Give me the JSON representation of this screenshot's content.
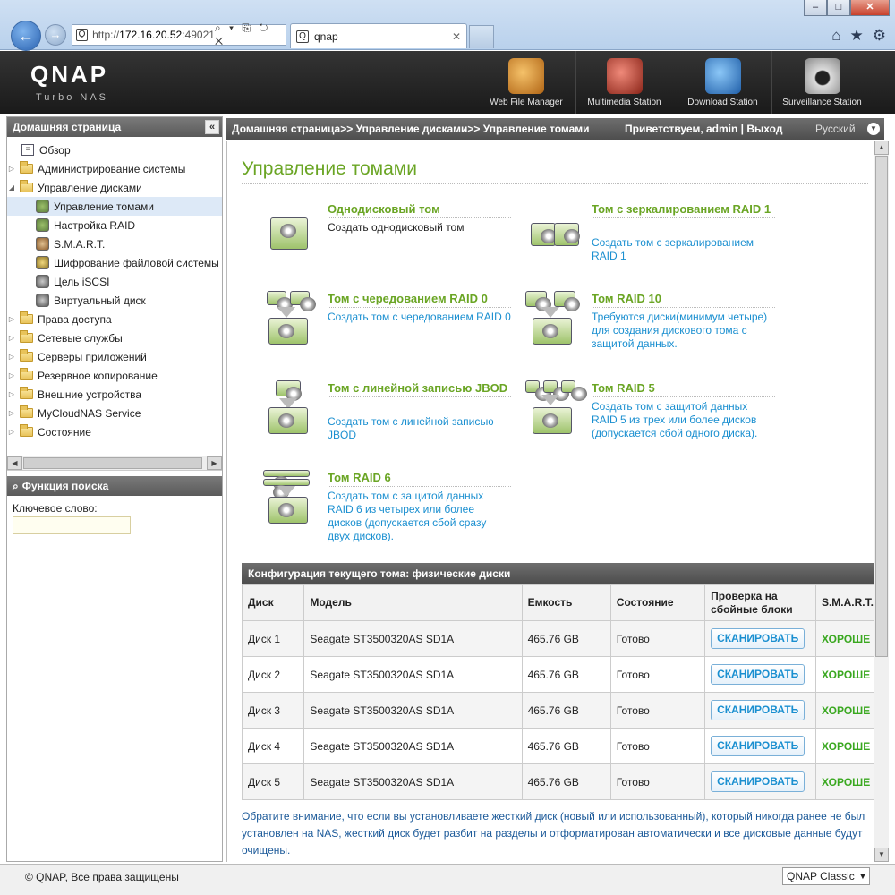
{
  "browser": {
    "address_prefix": "http://",
    "address_host": "172.16.20.52",
    "address_port": ":49021",
    "address_tools": "⌕ ▾ ⎘ ↻ ✕",
    "tab_title": "qnap",
    "tab_close": "✕",
    "window_controls": [
      "–",
      "□",
      "✕"
    ]
  },
  "header": {
    "logo": "QNAP",
    "sublogo": "Turbo NAS",
    "stations": [
      {
        "label": "Web File Manager",
        "icon": "web-file-manager-icon",
        "color": "#d88a2a"
      },
      {
        "label": "Multimedia Station",
        "icon": "multimedia-station-icon",
        "color": "#c94a3a"
      },
      {
        "label": "Download Station",
        "icon": "download-station-icon",
        "color": "#3a8bd8"
      },
      {
        "label": "Surveillance Station",
        "icon": "surveillance-station-icon",
        "color": "#888888"
      }
    ]
  },
  "sidebar": {
    "title": "Домашняя страница",
    "collapse": "«",
    "overview": "Обзор",
    "items": [
      {
        "label": "Администрирование системы",
        "expanded": false
      },
      {
        "label": "Управление дисками",
        "expanded": true
      }
    ],
    "sub_items": [
      {
        "label": "Управление томами",
        "selected": true
      },
      {
        "label": "Настройка RAID"
      },
      {
        "label": "S.M.A.R.T."
      },
      {
        "label": "Шифрование файловой системы"
      },
      {
        "label": "Цель iSCSI"
      },
      {
        "label": "Виртуальный диск"
      }
    ],
    "more_items": [
      "Права доступа",
      "Сетевые службы",
      "Серверы приложений",
      "Резервное копирование",
      "Внешние устройства",
      "MyCloudNAS Service",
      "Состояние"
    ],
    "search_title": "Функция поиска",
    "keyword_label": "Ключевое слово:",
    "keyword_value": ""
  },
  "topbar": {
    "breadcrumb": "Домашняя страница>> Управление дисками>> Управление томами",
    "greeting": "Приветствуем,  admin | Выход",
    "language": "Русский"
  },
  "main": {
    "title": "Управление томами",
    "options": [
      {
        "title": "Однодисковый том",
        "desc": "Создать однодисковый том"
      },
      {
        "title": "Том с зеркалированием RAID 1",
        "desc": "Создать том с зеркалированием RAID 1"
      },
      {
        "title": "Том с чередованием RAID 0",
        "desc": "Создать том с чередованием RAID 0"
      },
      {
        "title": "Том RAID 10",
        "desc": "Требуются диски(минимум четыре) для создания дискового тома с защитой данных."
      },
      {
        "title": "Том с линейной записью JBOD",
        "desc": "Создать том с линейной записью JBOD"
      },
      {
        "title": "Том RAID 5",
        "desc": "Создать том с защитой данных RAID 5 из трех или более дисков (допускается сбой одного диска)."
      },
      {
        "title": "Том RAID 6",
        "desc": "Создать том с защитой данных RAID 6 из четырех или более дисков (допускается сбой сразу двух дисков)."
      }
    ],
    "table": {
      "caption": "Конфигурация текущего тома: физические диски",
      "headers": [
        "Диск",
        "Модель",
        "Емкость",
        "Состояние",
        "Проверка на сбойные блоки",
        "S.M.A.R.T."
      ],
      "rows": [
        {
          "disk": "Диск 1",
          "model": "Seagate ST3500320AS SD1A",
          "capacity": "465.76 GB",
          "status": "Готово",
          "scan": "СКАНИРОВАТЬ",
          "smart": "ХОРОШЕ"
        },
        {
          "disk": "Диск 2",
          "model": "Seagate ST3500320AS SD1A",
          "capacity": "465.76 GB",
          "status": "Готово",
          "scan": "СКАНИРОВАТЬ",
          "smart": "ХОРОШЕ"
        },
        {
          "disk": "Диск 3",
          "model": "Seagate ST3500320AS SD1A",
          "capacity": "465.76 GB",
          "status": "Готово",
          "scan": "СКАНИРОВАТЬ",
          "smart": "ХОРОШЕ"
        },
        {
          "disk": "Диск 4",
          "model": "Seagate ST3500320AS SD1A",
          "capacity": "465.76 GB",
          "status": "Готово",
          "scan": "СКАНИРОВАТЬ",
          "smart": "ХОРОШЕ"
        },
        {
          "disk": "Диск 5",
          "model": "Seagate ST3500320AS SD1A",
          "capacity": "465.76 GB",
          "status": "Готово",
          "scan": "СКАНИРОВАТЬ",
          "smart": "ХОРОШЕ"
        }
      ]
    },
    "note": "Обратите внимание, что если вы установливаете жесткий диск (новый или использованный), который никогда ранее не был установлен на NAS, жесткий диск будет разбит на разделы и отформатирован автоматически и все дисковые данные будут очищены."
  },
  "footer": {
    "copyright": "© QNAP, Все права защищены",
    "style_select": "QNAP Classic"
  },
  "colors": {
    "accent_green": "#6aa524",
    "link_blue": "#1a8fd0",
    "good_green": "#3aa820"
  }
}
